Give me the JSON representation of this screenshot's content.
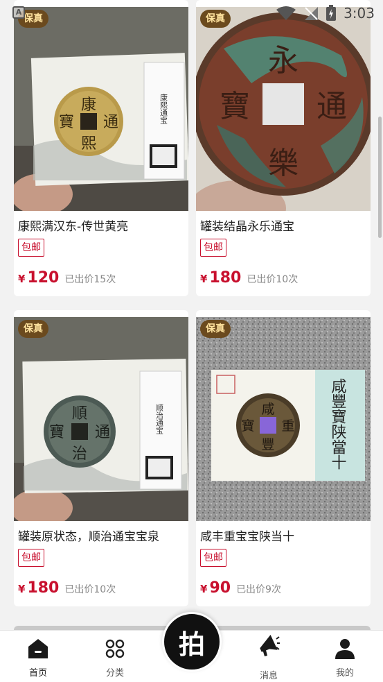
{
  "status_bar": {
    "time": "3:03",
    "indicator": "A"
  },
  "products": [
    {
      "badge": "保真",
      "title": "康熙满汉东-传世黄亮",
      "tag": "包邮",
      "currency": "¥",
      "price": "120",
      "sold": "已出价15次",
      "coin_chars": [
        "康",
        "熙",
        "通",
        "寶"
      ],
      "label_text": "康熙通宝"
    },
    {
      "badge": "保真",
      "title": "罐装结晶永乐通宝",
      "tag": "包邮",
      "currency": "¥",
      "price": "180",
      "sold": "已出价10次",
      "coin_chars": [
        "永",
        "樂",
        "通",
        "寶"
      ]
    },
    {
      "badge": "保真",
      "title": "罐装原状态，顺治通宝宝泉",
      "tag": "包邮",
      "currency": "¥",
      "price": "180",
      "sold": "已出价10次",
      "coin_chars": [
        "順",
        "治",
        "通",
        "寶"
      ],
      "label_text": "顺治通宝"
    },
    {
      "badge": "保真",
      "title": "咸丰重宝宝陕当十",
      "tag": "包邮",
      "currency": "¥",
      "price": "90",
      "sold": "已出价9次",
      "coin_chars": [
        "咸",
        "豐",
        "重",
        "寶"
      ],
      "label_text": "咸豐寶陕當十"
    }
  ],
  "bottom_nav": {
    "items": [
      {
        "label": "首页",
        "icon": "home-icon"
      },
      {
        "label": "分类",
        "icon": "category-icon"
      },
      {
        "label": "消息",
        "icon": "megaphone-icon"
      },
      {
        "label": "我的",
        "icon": "profile-icon"
      }
    ],
    "center_button": "拍"
  },
  "colors": {
    "price": "#c8102e",
    "badge_bg": "#6b4a1e",
    "badge_text": "#ffe39e"
  }
}
